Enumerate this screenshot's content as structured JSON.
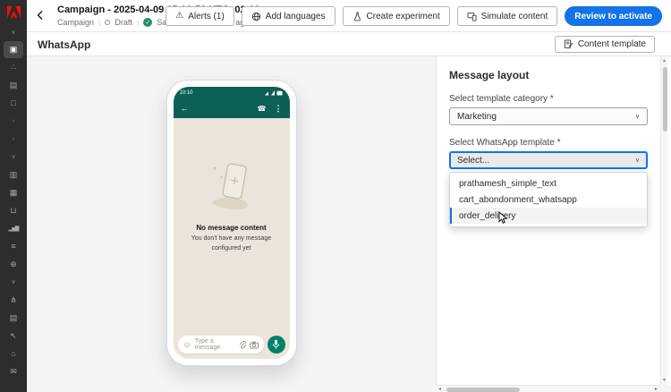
{
  "colors": {
    "accent_blue": "#1473e6",
    "whatsapp_teal": "#0b6156",
    "whatsapp_chat_bg": "#ece4db",
    "mic_green": "#00806a",
    "saved_check_green": "#278e6d",
    "sidebar_bg": "#2d2d2d",
    "adobe_red": "#fa0f00",
    "canvas_bg": "#f4f4f4"
  },
  "icons": {
    "warning": "⚠",
    "check": "✓",
    "separator": "|",
    "select_chevron": "∨",
    "scroll_up": "▲",
    "scroll_down": "▼",
    "scroll_left": "◄",
    "scroll_right": "►"
  },
  "sidebar": {
    "icons": [
      {
        "name": "chevron-down-icon",
        "glyph": "∨"
      },
      {
        "name": "campaign-icon",
        "glyph": "▣",
        "active": true
      },
      {
        "name": "share-icon",
        "glyph": "∴"
      },
      {
        "name": "assets-icon",
        "glyph": "▤"
      },
      {
        "name": "document-icon",
        "glyph": "□"
      },
      {
        "name": "chevron-right-icon",
        "glyph": "›"
      },
      {
        "name": "chevron-right-icon",
        "glyph": "›"
      },
      {
        "name": "chevron-down-icon",
        "glyph": "∨"
      },
      {
        "name": "copy-icon",
        "glyph": "▥"
      },
      {
        "name": "calendar-icon",
        "glyph": "▦"
      },
      {
        "name": "inbox-icon",
        "glyph": "⊔"
      },
      {
        "name": "chart-icon",
        "glyph": "▂▅▇"
      },
      {
        "name": "list-icon",
        "glyph": "≡"
      },
      {
        "name": "globe-icon",
        "glyph": "⊕"
      },
      {
        "name": "chevron-down-icon",
        "glyph": "∨"
      },
      {
        "name": "flow-icon",
        "glyph": "⋔"
      },
      {
        "name": "rows-icon",
        "glyph": "▤"
      },
      {
        "name": "cursor-icon",
        "glyph": "↖"
      },
      {
        "name": "home-icon",
        "glyph": "⌂"
      },
      {
        "name": "mail-icon",
        "glyph": "✉"
      }
    ]
  },
  "header": {
    "title": "Campaign - 2025-04-09 15:00:58 UTC+02:00",
    "breadcrumb": "Campaign",
    "status": "Draft",
    "saved": "Saved a few seconds ago",
    "actions": {
      "alerts": "Alerts (1)",
      "add_languages": "Add languages",
      "create_experiment": "Create experiment",
      "simulate_content": "Simulate content",
      "review_to_activate": "Review to activate"
    }
  },
  "toolbar": {
    "channel": "WhatsApp",
    "content_template": "Content template"
  },
  "phone": {
    "status_time": "10:10",
    "back_arrow": "←",
    "call_icon": "☎",
    "menu_dots": "⋮",
    "emoji_icon": "☺",
    "empty_title": "No message content",
    "empty_subtitle": "You don't have any message configured yet",
    "input_placeholder": "Type a message"
  },
  "panel": {
    "title": "Message layout",
    "category_label": "Select template category *",
    "category_value": "Marketing",
    "template_label": "Select WhatsApp template *",
    "template_value": "Select...",
    "options": [
      "prathamesh_simple_text",
      "cart_abondonment_whatsapp",
      "order_delivery"
    ],
    "highlighted_option": "order_delivery"
  }
}
